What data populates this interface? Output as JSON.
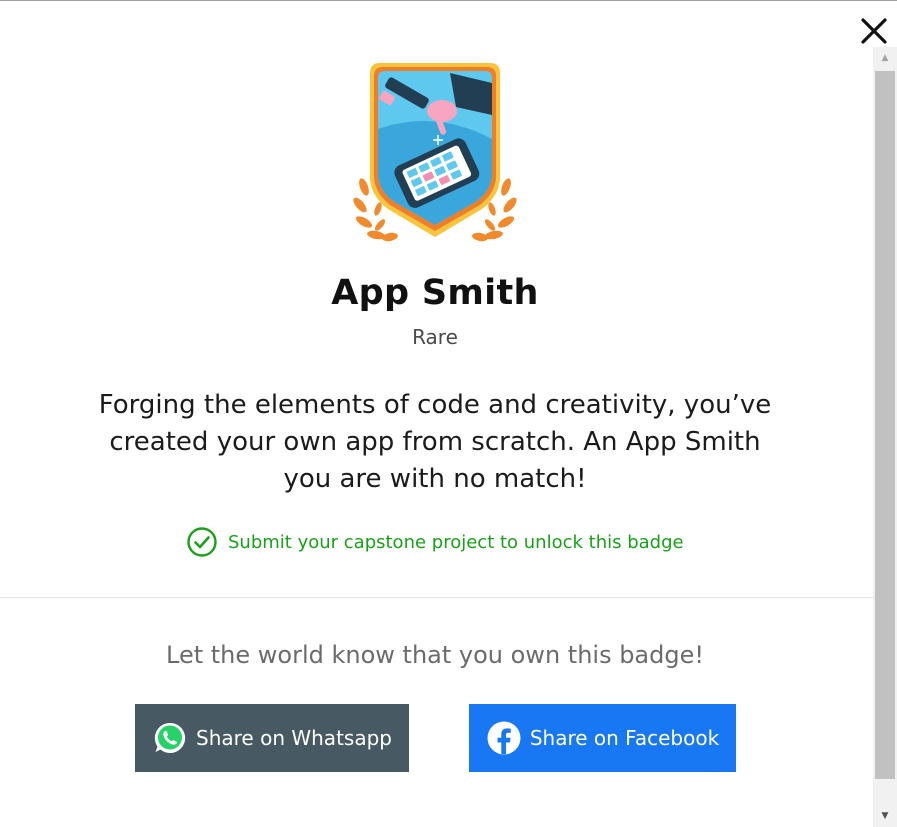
{
  "modal": {
    "close_icon": "close-icon"
  },
  "badge": {
    "image_icon": "app-smith-badge",
    "title": "App Smith",
    "rarity": "Rare",
    "description": "Forging the elements of code and creativity, you’ve created your own app from scratch. An App Smith you are with no match!",
    "unlock_text": "Submit your capstone project to unlock this badge",
    "unlock_color": "#18a118"
  },
  "share": {
    "prompt": "Let the world know that you own this badge!",
    "whatsapp_label": "Share on Whatsapp",
    "whatsapp_color": "#475a63",
    "facebook_label": "Share on Facebook",
    "facebook_color": "#1877f2"
  }
}
